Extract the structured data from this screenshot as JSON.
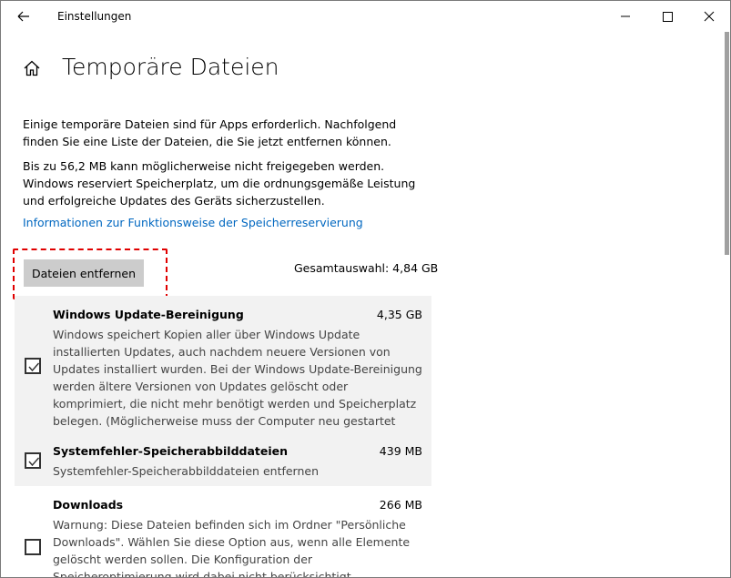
{
  "window": {
    "title": "Einstellungen",
    "back_icon": "arrow-left-icon",
    "controls": [
      "minimize-icon",
      "maximize-icon",
      "close-icon"
    ]
  },
  "page": {
    "title": "Temporäre Dateien",
    "home_icon": "home-icon",
    "intro": "Einige temporäre Dateien sind für Apps erforderlich. Nachfolgend finden Sie eine Liste der Dateien, die Sie jetzt entfernen können.",
    "reserve_info": "Bis zu 56,2 MB kann möglicherweise nicht freigegeben werden. Windows reserviert Speicherplatz, um die ordnungsgemäße Leistung und erfolgreiche Updates des Geräts sicherzustellen.",
    "link": "Informationen zur Funktionsweise der Speicherreservierung",
    "remove_button": "Dateien entfernen",
    "total_selection": "Gesamtauswahl: 4,84 GB",
    "highlight_color": "#e00000",
    "link_color": "#0067c0"
  },
  "items": [
    {
      "name": "Windows Update-Bereinigung",
      "size": "4,35 GB",
      "checked": true,
      "description": "Windows speichert Kopien aller über Windows Update installierten Updates, auch nachdem neuere Versionen von Updates installiert wurden. Bei der Windows Update-Bereinigung werden ältere Versionen von Updates gelöscht oder komprimiert, die nicht mehr benötigt werden und Speicherplatz belegen. (Möglicherweise muss der Computer neu gestartet werden.)"
    },
    {
      "name": "Systemfehler-Speicherabbilddateien",
      "size": "439 MB",
      "checked": true,
      "description": "Systemfehler-Speicherabbilddateien entfernen"
    },
    {
      "name": "Downloads",
      "size": "266 MB",
      "checked": false,
      "description": "Warnung: Diese Dateien befinden sich im Ordner \"Persönliche Downloads\". Wählen Sie diese Option aus, wenn alle Elemente gelöscht werden sollen. Die Konfiguration der Speicheroptimierung wird dabei nicht berücksichtigt."
    }
  ]
}
